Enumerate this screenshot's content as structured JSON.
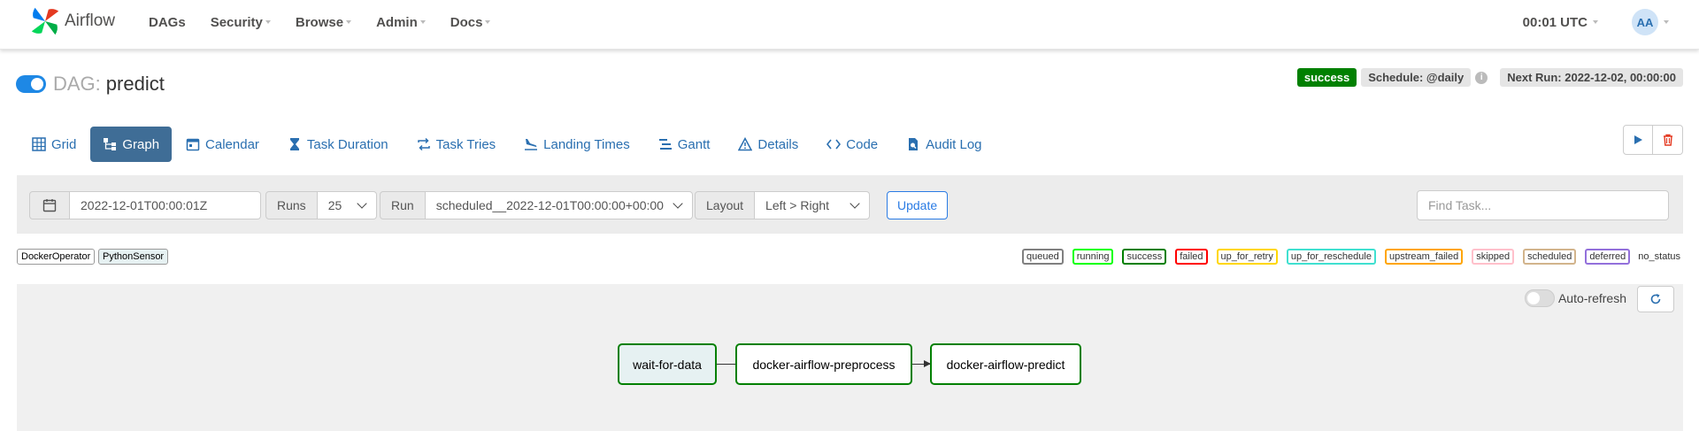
{
  "navbar": {
    "brand": "Airflow",
    "items": [
      {
        "label": "DAGs"
      },
      {
        "label": "Security"
      },
      {
        "label": "Browse"
      },
      {
        "label": "Admin"
      },
      {
        "label": "Docs"
      }
    ],
    "clock": "00:01 UTC",
    "user_initials": "AA"
  },
  "dag": {
    "label": "DAG:",
    "name": "predict",
    "state_badge": "success",
    "schedule": "Schedule: @daily",
    "next_run": "Next Run: 2022-12-02, 00:00:00"
  },
  "tabs": [
    {
      "label": "Grid",
      "icon": "grid-icon"
    },
    {
      "label": "Graph",
      "icon": "graph-icon"
    },
    {
      "label": "Calendar",
      "icon": "calendar-icon"
    },
    {
      "label": "Task Duration",
      "icon": "hourglass-icon"
    },
    {
      "label": "Task Tries",
      "icon": "retry-icon"
    },
    {
      "label": "Landing Times",
      "icon": "plane-landing-icon"
    },
    {
      "label": "Gantt",
      "icon": "gantt-icon"
    },
    {
      "label": "Details",
      "icon": "warning-icon"
    },
    {
      "label": "Code",
      "icon": "code-icon"
    },
    {
      "label": "Audit Log",
      "icon": "audit-icon"
    }
  ],
  "filters": {
    "date_value": "2022-12-01T00:00:01Z",
    "runs_label": "Runs",
    "runs_value": "25",
    "run_label": "Run",
    "run_value": "scheduled__2022-12-01T00:00:00+00:00",
    "layout_label": "Layout",
    "layout_value": "Left > Right",
    "update_label": "Update",
    "find_task_placeholder": "Find Task..."
  },
  "operators": [
    "DockerOperator",
    "PythonSensor"
  ],
  "states": [
    {
      "label": "queued",
      "color": "#808080"
    },
    {
      "label": "running",
      "color": "#00ff00"
    },
    {
      "label": "success",
      "color": "#008000"
    },
    {
      "label": "failed",
      "color": "#ff0000"
    },
    {
      "label": "up_for_retry",
      "color": "#ffd700"
    },
    {
      "label": "up_for_reschedule",
      "color": "#40e0d0"
    },
    {
      "label": "upstream_failed",
      "color": "#ffa500"
    },
    {
      "label": "skipped",
      "color": "#ffc0cb"
    },
    {
      "label": "scheduled",
      "color": "#d2b48c"
    },
    {
      "label": "deferred",
      "color": "#9370db"
    },
    {
      "label": "no_status",
      "color": "none"
    }
  ],
  "graph": {
    "auto_refresh_label": "Auto-refresh",
    "nodes": [
      {
        "label": "wait-for-data"
      },
      {
        "label": "docker-airflow-preprocess"
      },
      {
        "label": "docker-airflow-predict"
      }
    ]
  }
}
